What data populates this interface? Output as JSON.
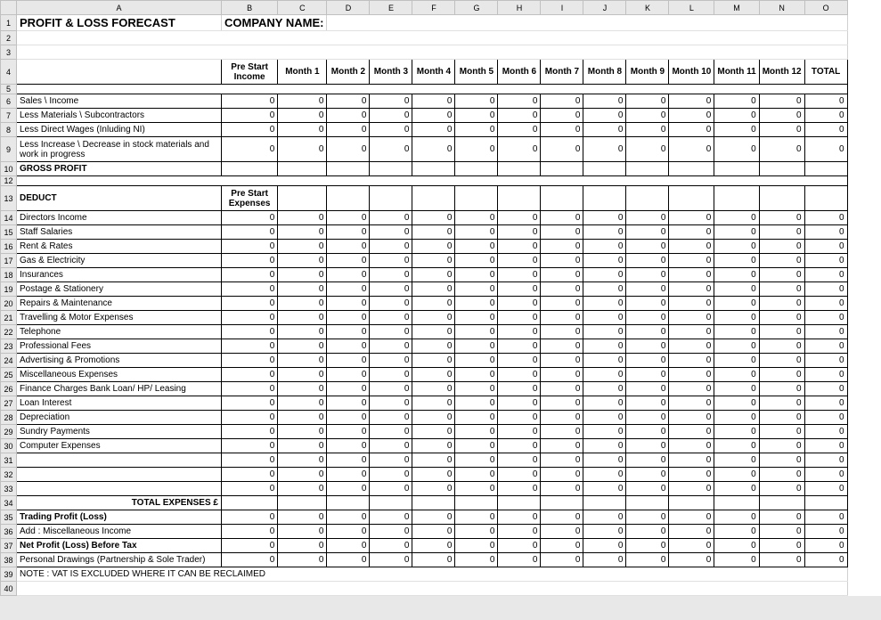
{
  "columns": [
    "",
    "A",
    "B",
    "C",
    "D",
    "E",
    "F",
    "G",
    "H",
    "I",
    "J",
    "K",
    "L",
    "M",
    "N",
    "O"
  ],
  "title": "PROFIT & LOSS FORECAST",
  "company_label": "COMPANY NAME:",
  "headers": {
    "prestart_income": "Pre Start Income",
    "prestart_expenses": "Pre Start Expenses",
    "months": [
      "Month 1",
      "Month 2",
      "Month 3",
      "Month 4",
      "Month 5",
      "Month 6",
      "Month 7",
      "Month 8",
      "Month 9",
      "Month 10",
      "Month 11",
      "Month 12"
    ],
    "total": "TOTAL"
  },
  "section_gross": "GROSS PROFIT",
  "section_deduct": "DEDUCT",
  "section_total_exp": "TOTAL EXPENSES £",
  "rows_income": [
    "Sales \\ Income",
    "Less Materials \\ Subcontractors",
    "Less Direct Wages (Inluding NI)",
    "Less Increase \\ Decrease in stock materials and work in progress"
  ],
  "rows_expenses": [
    "Directors Income",
    "Staff Salaries",
    "Rent & Rates",
    "Gas & Electricity",
    "Insurances",
    "Postage & Stationery",
    "Repairs & Maintenance",
    "Travelling & Motor Expenses",
    "Telephone",
    "Professional Fees",
    "Advertising & Promotions",
    "Miscellaneous Expenses",
    "Finance Charges Bank Loan/ HP/ Leasing",
    "Loan Interest",
    "Depreciation",
    "Sundry Payments",
    "Computer Expenses",
    "",
    "",
    ""
  ],
  "rows_bottom": [
    "Trading Profit (Loss)",
    "Add : Miscellaneous Income",
    "Net Profit (Loss) Before Tax",
    "Personal Drawings (Partnership & Sole Trader)"
  ],
  "note": "NOTE : VAT IS EXCLUDED WHERE IT CAN BE RECLAIMED",
  "zero": "0",
  "chart_data": {
    "type": "table",
    "title": "PROFIT & LOSS FORECAST",
    "columns": [
      "Pre Start",
      "Month 1",
      "Month 2",
      "Month 3",
      "Month 4",
      "Month 5",
      "Month 6",
      "Month 7",
      "Month 8",
      "Month 9",
      "Month 10",
      "Month 11",
      "Month 12",
      "TOTAL"
    ],
    "sections": {
      "income": {
        "rows": [
          "Sales \\ Income",
          "Less Materials \\ Subcontractors",
          "Less Direct Wages (Inluding NI)",
          "Less Increase \\ Decrease in stock materials and work in progress"
        ],
        "values_all_zero": true
      },
      "gross_profit": {
        "values_all_zero": true
      },
      "deduct": {
        "rows": [
          "Directors Income",
          "Staff Salaries",
          "Rent & Rates",
          "Gas & Electricity",
          "Insurances",
          "Postage & Stationery",
          "Repairs & Maintenance",
          "Travelling & Motor Expenses",
          "Telephone",
          "Professional Fees",
          "Advertising & Promotions",
          "Miscellaneous Expenses",
          "Finance Charges Bank Loan/ HP/ Leasing",
          "Loan Interest",
          "Depreciation",
          "Sundry Payments",
          "Computer Expenses",
          "",
          "",
          ""
        ],
        "values_all_zero": true
      },
      "total_expenses": {
        "values_all_zero": true
      },
      "bottom": {
        "rows": [
          "Trading Profit (Loss)",
          "Add : Miscellaneous Income",
          "Net Profit (Loss) Before Tax",
          "Personal Drawings (Partnership & Sole Trader)"
        ],
        "values_all_zero": true
      }
    }
  }
}
